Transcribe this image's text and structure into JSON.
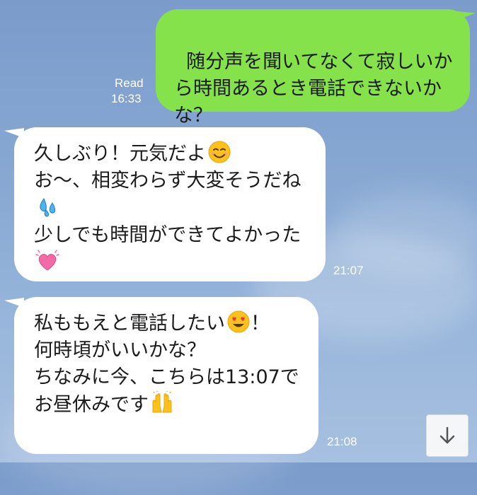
{
  "conversation": {
    "sent_message": {
      "text": "随分声を聞いてなくて寂しいから時間あるとき電話できないかな？",
      "status": "Read",
      "time": "16:33"
    },
    "reply1": {
      "line1": "久しぶり！元気だよ",
      "line2": "お〜、相変わらず大変そうだね",
      "line3": "少しでも時間ができてよかった",
      "time": "21:07",
      "emojis": [
        "smiling-face-icon",
        "sweat-droplets-icon",
        "heart-icon"
      ]
    },
    "reply2": {
      "line1a": "私ももえと電話したい",
      "line1b": "！",
      "line2": "何時頃がいいかな？",
      "line3": "ちなみに今、こちらは13:07で",
      "line4": "お昼休みです",
      "time": "21:08",
      "emojis": [
        "heart-eyes-face-icon",
        "raised-hands-icon"
      ]
    }
  },
  "scroll_button": {
    "icon": "arrow-down-icon"
  },
  "colors": {
    "sent_bubble": "#86e24a",
    "received_bubble": "#ffffff",
    "background": "#8aaad4"
  }
}
